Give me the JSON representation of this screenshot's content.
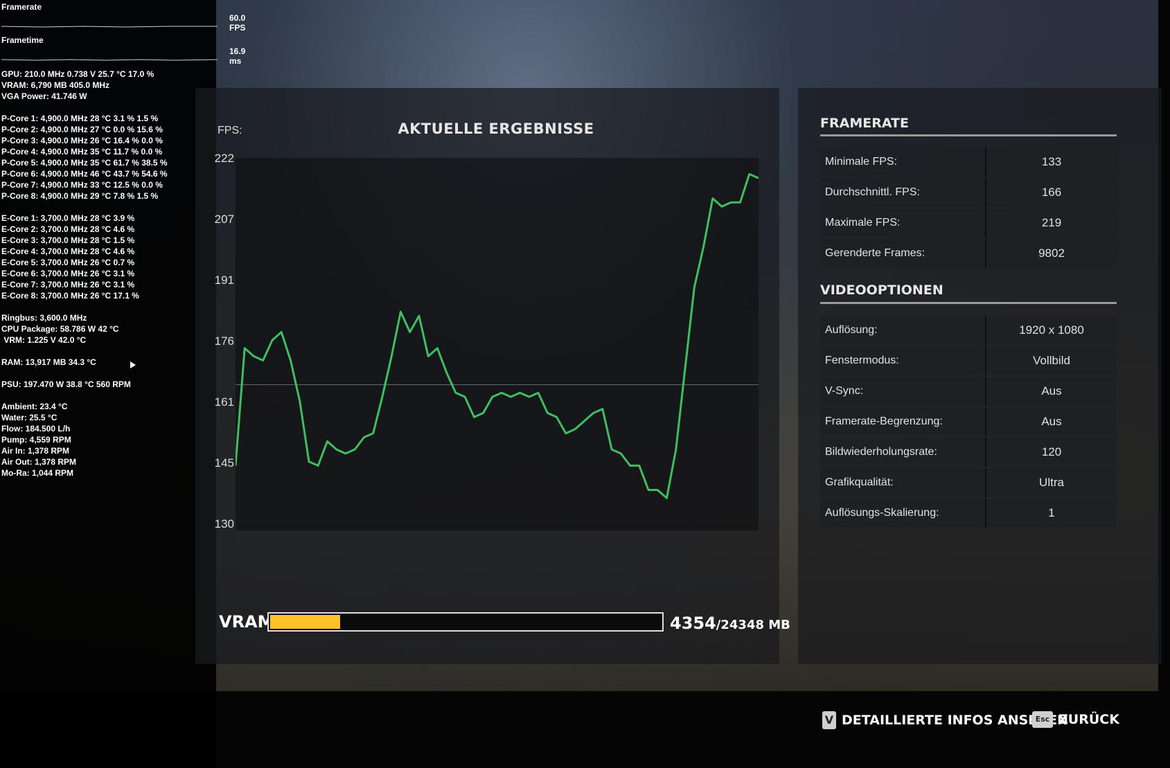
{
  "osd": {
    "framerate_label": "Framerate",
    "framerate_value": "60.0 FPS",
    "frametime_label": "Frametime",
    "frametime_value": "16.9 ms",
    "lines": [
      "GPU: 210.0 MHz 0.738 V 25.7 °C 17.0 %",
      "VRAM: 6,790 MB 405.0 MHz",
      "VGA Power: 41.746 W",
      "",
      "P-Core 1: 4,900.0 MHz 28 °C 3.1 % 1.5 %",
      "P-Core 2: 4,900.0 MHz 27 °C 0.0 % 15.6 %",
      "P-Core 3: 4,900.0 MHz 26 °C 16.4 % 0.0 %",
      "P-Core 4: 4,900.0 MHz 35 °C 11.7 % 0.0 %",
      "P-Core 5: 4,900.0 MHz 35 °C 61.7 % 38.5 %",
      "P-Core 6: 4,900.0 MHz 46 °C 43.7 % 54.6 %",
      "P-Core 7: 4,900.0 MHz 33 °C 12.5 % 0.0 %",
      "P-Core 8: 4,900.0 MHz 29 °C 7.8 % 1.5 %",
      "",
      "E-Core 1: 3,700.0 MHz 28 °C 3.9 %",
      "E-Core 2: 3,700.0 MHz 28 °C 4.6 %",
      "E-Core 3: 3,700.0 MHz 28 °C 1.5 %",
      "E-Core 4: 3,700.0 MHz 28 °C 4.6 %",
      "E-Core 5: 3,700.0 MHz 26 °C 0.7 %",
      "E-Core 6: 3,700.0 MHz 26 °C 3.1 %",
      "E-Core 7: 3,700.0 MHz 26 °C 3.1 %",
      "E-Core 8: 3,700.0 MHz 26 °C 17.1 %",
      "",
      "Ringbus: 3,600.0 MHz",
      "CPU Package: 58.786 W 42 °C",
      " VRM: 1.225 V 42.0 °C",
      "",
      "RAM: 13,917 MB 34.3 °C",
      "",
      "PSU: 197.470 W 38.8 °C 560 RPM",
      "",
      "Ambient: 23.4 °C",
      "Water: 25.5 °C",
      "Flow: 184.500 L/h",
      "Pump: 4,559 RPM",
      "Air In: 1,378 RPM",
      "Air Out: 1,378 RPM",
      "Mo-Ra: 1,044 RPM"
    ]
  },
  "chart": {
    "title": "AKTUELLE ERGEBNISSE",
    "ylabel": "FPS:",
    "yticks": [
      "222",
      "207",
      "191",
      "176",
      "161",
      "145",
      "130"
    ]
  },
  "chart_data": {
    "type": "line",
    "title": "AKTUELLE ERGEBNISSE",
    "xlabel": "",
    "ylabel": "FPS:",
    "ylim": [
      130,
      222
    ],
    "grid": false,
    "legend": "none",
    "reference_line": 166,
    "series_color": "#3fbf5f",
    "series": [
      {
        "values": [
          146,
          175,
          173,
          172,
          177,
          179,
          172,
          162,
          147,
          146,
          152,
          150,
          149,
          150,
          153,
          154,
          163,
          173,
          184,
          179,
          183,
          173,
          175,
          169,
          164,
          163,
          158,
          159,
          163,
          164,
          163,
          164,
          163,
          164,
          159,
          158,
          154,
          155,
          157,
          159,
          160,
          150,
          149,
          146,
          146,
          140,
          140,
          138,
          150,
          170,
          190,
          200,
          212,
          210,
          211,
          211,
          218,
          217
        ]
      }
    ]
  },
  "vram": {
    "label": "VRAM",
    "used": "4354",
    "total": "/24348 MB",
    "fill_fraction": 0.1788
  },
  "framerate_section": {
    "title": "FRAMERATE",
    "rows": [
      {
        "label": "Minimale FPS:",
        "value": "133"
      },
      {
        "label": "Durchschnittl. FPS:",
        "value": "166"
      },
      {
        "label": "Maximale FPS:",
        "value": "219"
      },
      {
        "label": "Gerenderte Frames:",
        "value": "9802"
      }
    ]
  },
  "video_section": {
    "title": "VIDEOOPTIONEN",
    "rows": [
      {
        "label": "Auflösung:",
        "value": "1920 x 1080"
      },
      {
        "label": "Fenstermodus:",
        "value": "Vollbild"
      },
      {
        "label": "V-Sync:",
        "value": "Aus"
      },
      {
        "label": "Framerate-Begrenzung:",
        "value": "Aus"
      },
      {
        "label": "Bildwiederholungsrate:",
        "value": "120"
      },
      {
        "label": "Grafikqualität:",
        "value": "Ultra"
      },
      {
        "label": "Auflösungs-Skalierung:",
        "value": "1"
      }
    ]
  },
  "footer": {
    "details_key": "V",
    "details_label": "DETAILLIERTE INFOS ANSEHEN",
    "back_key": "Esc",
    "back_label": "ZURÜCK"
  },
  "colors": {
    "accent_yellow": "#ffc229",
    "line_green": "#3fbf5f"
  }
}
